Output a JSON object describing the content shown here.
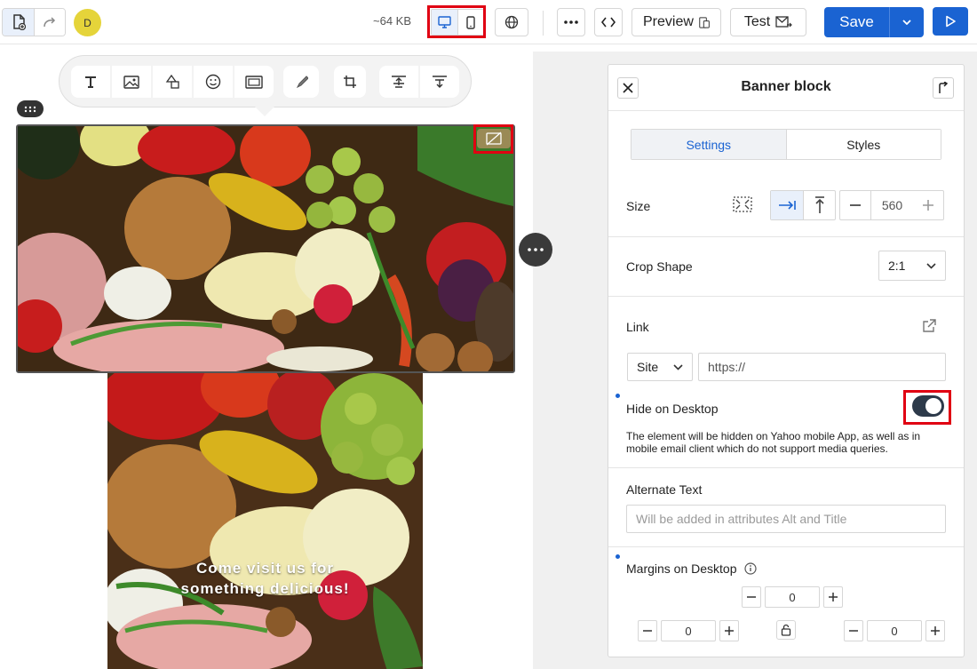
{
  "topbar": {
    "avatar_initial": "D",
    "size_label": "~64 KB",
    "preview_label": "Preview",
    "test_label": "Test",
    "save_label": "Save"
  },
  "icons": {
    "new_doc": "file-plus-icon",
    "redo": "redo-icon",
    "desktop": "desktop-icon",
    "mobile": "mobile-icon",
    "globe": "globe-icon",
    "more": "more-horizontal-icon",
    "code": "code-icon",
    "preview": "device-preview-icon",
    "test": "mail-send-icon",
    "play": "play-icon"
  },
  "canvas": {
    "banner_text_line1": "Come visit us for",
    "banner_text_line2": "something delicious!"
  },
  "panel": {
    "title": "Banner block",
    "tabs": [
      {
        "label": "Settings",
        "active": true
      },
      {
        "label": "Styles",
        "active": false
      }
    ],
    "size": {
      "label": "Size",
      "value": "560"
    },
    "crop_shape": {
      "label": "Crop Shape",
      "value": "2:1"
    },
    "link": {
      "label": "Link",
      "type": "Site",
      "url_placeholder": "https://"
    },
    "hide_on_desktop": {
      "label": "Hide on Desktop",
      "enabled": true,
      "helper": "The element will be hidden on Yahoo mobile App, as well as in mobile email client which do not support media queries."
    },
    "alt_text": {
      "label": "Alternate Text",
      "placeholder": "Will be added in attributes Alt and Title"
    },
    "margins": {
      "label": "Margins on Desktop",
      "top": "0",
      "left": "0",
      "right": "0"
    }
  },
  "colors": {
    "accent": "#1a63d2",
    "highlight_red": "#e00012",
    "toggle_on": "#2d3a4a"
  }
}
